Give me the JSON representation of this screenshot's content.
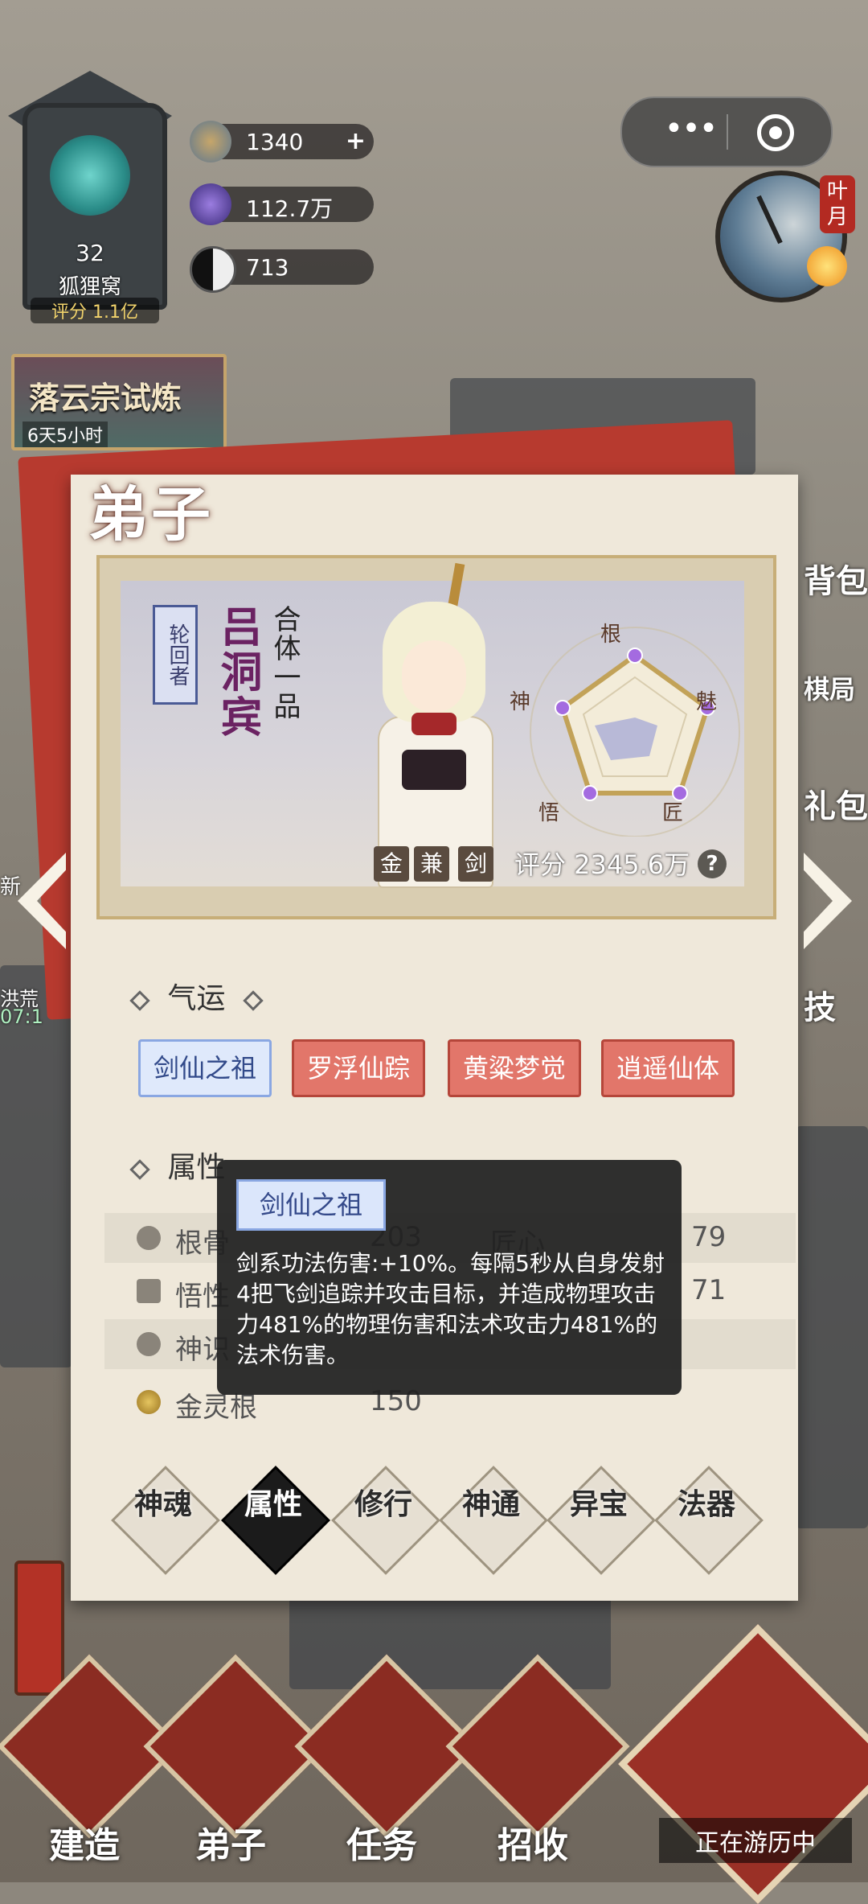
{
  "player": {
    "level": "32",
    "name": "狐狸窝",
    "score": "评分 1.1亿"
  },
  "resources": [
    {
      "icon": "spirit-stone-icon",
      "value": "1340",
      "plus": "+"
    },
    {
      "icon": "crystal-icon",
      "value": "112.7万"
    },
    {
      "icon": "yin-yang-icon",
      "value": "713"
    }
  ],
  "capsule": {
    "more": "•••"
  },
  "clock": {
    "label": "叶月"
  },
  "event": {
    "title": "落云宗试炼",
    "time": "6天5小时"
  },
  "side_right": [
    "背包",
    "棋局",
    "礼包",
    "技"
  ],
  "side_left": [
    "新",
    "洪荒",
    "07:1"
  ],
  "panel": {
    "title": "弟子",
    "character": {
      "rank": "轮回者",
      "name": "吕洞宾",
      "realm": "合体一品",
      "elements": [
        "金",
        "兼",
        "剑"
      ],
      "score": "评分 2345.6万",
      "help": "?",
      "radar_labels": [
        "根",
        "魅",
        "匠",
        "悟",
        "神"
      ]
    },
    "fortune": {
      "title": "气运",
      "items": [
        {
          "label": "剑仙之祖",
          "selected": true
        },
        {
          "label": "罗浮仙踪",
          "selected": false
        },
        {
          "label": "黄粱梦觉",
          "selected": false
        },
        {
          "label": "逍遥仙体",
          "selected": false
        }
      ]
    },
    "attributes": {
      "title": "属性",
      "rows": [
        {
          "a_name": "根骨",
          "a_value": "203",
          "b_name": "匠心",
          "b_value": "79"
        },
        {
          "a_name": "悟性",
          "a_value": "",
          "b_name": "",
          "b_value": "71"
        },
        {
          "a_name": "神识",
          "a_value": "",
          "b_name": "",
          "b_value": ""
        },
        {
          "a_name": "金灵根",
          "a_value": "150",
          "b_name": "",
          "b_value": ""
        }
      ]
    },
    "tooltip": {
      "tag": "剑仙之祖",
      "description": "剑系功法伤害:+10%。每隔5秒从自身发射4把飞剑追踪并攻击目标，并造成物理攻击力481%的物理伤害和法术攻击力481%的法术伤害。"
    },
    "tabs": [
      {
        "label": "神魂",
        "active": false
      },
      {
        "label": "属性",
        "active": true
      },
      {
        "label": "修行",
        "active": false
      },
      {
        "label": "神通",
        "active": false
      },
      {
        "label": "异宝",
        "active": false
      },
      {
        "label": "法器",
        "active": false
      }
    ]
  },
  "bottom_nav": [
    {
      "label": "建造"
    },
    {
      "label": "弟子"
    },
    {
      "label": "任务"
    },
    {
      "label": "招收"
    }
  ],
  "travel": {
    "label": "正在游历中"
  },
  "colors": {
    "panel": "#efe8da",
    "accent_red": "#b73a2f",
    "name_purple": "#6b2262"
  }
}
